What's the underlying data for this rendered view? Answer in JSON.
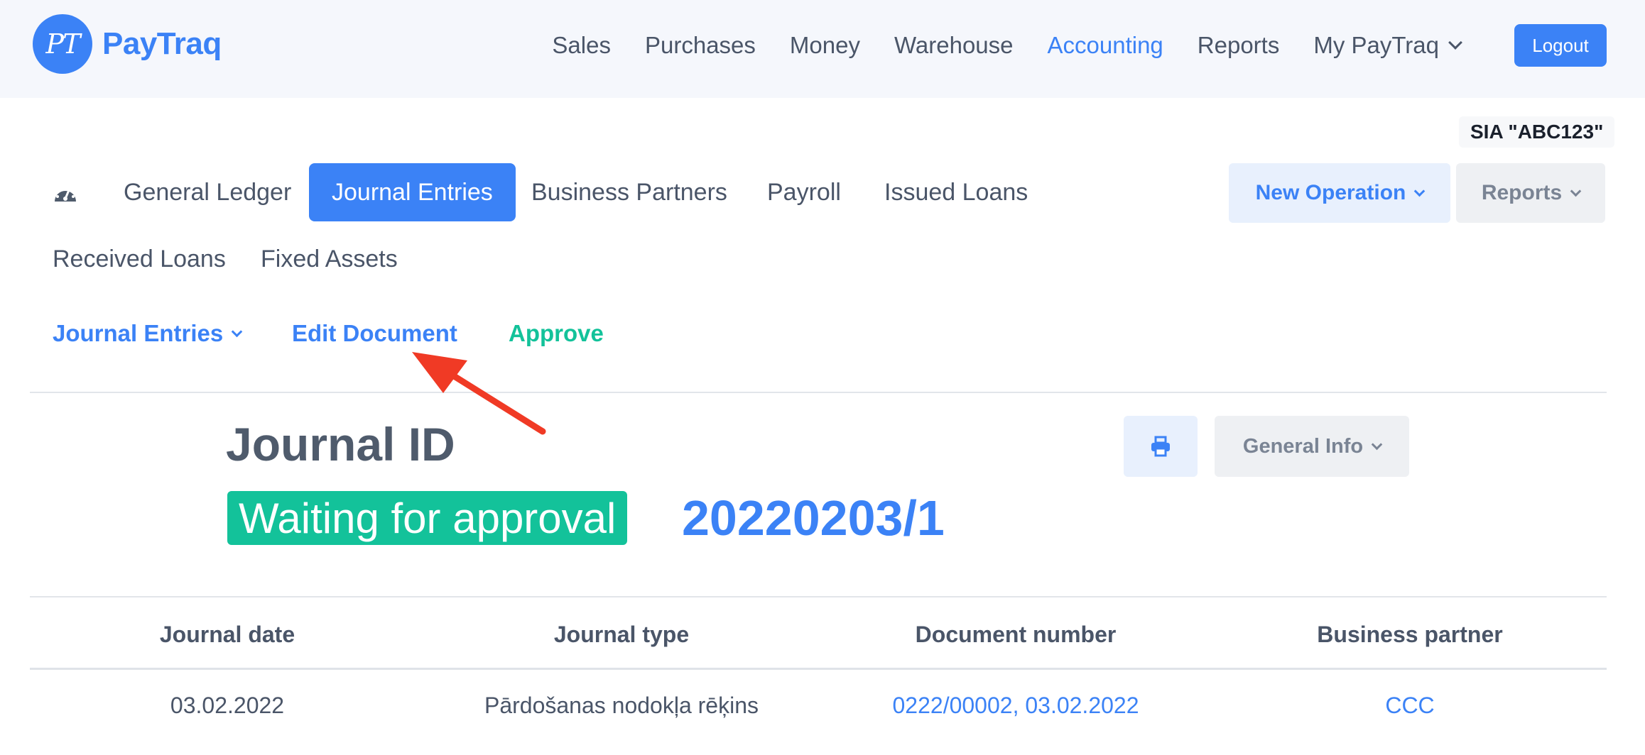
{
  "app": {
    "logo_initials": "PT",
    "logo_text": "PayTraq",
    "brand_color": "#3b82f6",
    "accent_green": "#13c29a"
  },
  "topnav": {
    "items": [
      {
        "label": "Sales"
      },
      {
        "label": "Purchases"
      },
      {
        "label": "Money"
      },
      {
        "label": "Warehouse"
      },
      {
        "label": "Accounting",
        "active": true
      },
      {
        "label": "Reports"
      },
      {
        "label": "My PayTraq",
        "dropdown": true
      }
    ],
    "logout_label": "Logout"
  },
  "company": "SIA \"ABC123\"",
  "tabs": {
    "dashboard_icon": "gauge-icon",
    "items": [
      {
        "label": "General Ledger"
      },
      {
        "label": "Journal Entries",
        "active": true
      },
      {
        "label": "Business Partners"
      },
      {
        "label": "Payroll"
      },
      {
        "label": "Issued Loans"
      },
      {
        "label": "Received Loans"
      },
      {
        "label": "Fixed Assets"
      }
    ],
    "new_operation_label": "New Operation",
    "reports_label": "Reports"
  },
  "actions": {
    "journal_entries_label": "Journal Entries",
    "edit_document_label": "Edit Document",
    "approve_label": "Approve"
  },
  "journal": {
    "title": "Journal ID",
    "status": "Waiting for approval",
    "number": "20220203/1",
    "print_icon": "print-icon",
    "general_info_label": "General Info"
  },
  "table": {
    "columns": [
      "Journal date",
      "Journal type",
      "Document number",
      "Business partner"
    ],
    "rows": [
      {
        "date": "03.02.2022",
        "type": "Pārdošanas nodokļa rēķins",
        "document": "0222/00002, 03.02.2022",
        "partner": "CCC"
      }
    ]
  }
}
